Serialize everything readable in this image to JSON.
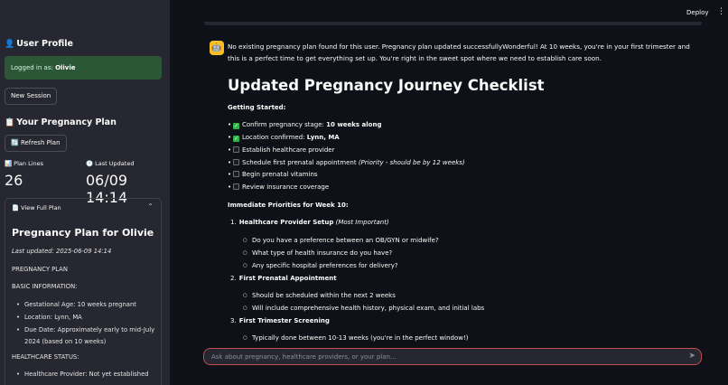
{
  "sidebar": {
    "user_profile_heading": "User Profile",
    "logged_in_prefix": "Logged in as:",
    "username": "Olivie",
    "new_session_label": "New Session",
    "plan_heading": "Your Pregnancy Plan",
    "refresh_label": "Refresh Plan",
    "metrics": [
      {
        "label": "Plan Lines",
        "value": "26"
      },
      {
        "label": "Last Updated",
        "value": "06/09 14:14"
      }
    ],
    "expander_label": "View Full Plan",
    "plan": {
      "title": "Pregnancy Plan for Olivie",
      "last_updated": "Last updated: 2025-06-09 14:14",
      "heading": "PREGNANCY PLAN",
      "basic_info_heading": "BASIC INFORMATION:",
      "basic_info": [
        "Gestational Age: 10 weeks pregnant",
        "Location: Lynn, MA",
        "Due Date: Approximately early to mid-July 2024 (based on 10 weeks)"
      ],
      "healthcare_heading": "HEALTHCARE STATUS:",
      "healthcare": [
        "Healthcare Provider: Not yet established"
      ]
    }
  },
  "header": {
    "deploy_label": "Deploy",
    "menu_icon": "⋮"
  },
  "chat": {
    "assistant_intro": "No existing pregnancy plan found for this user. Pregnancy plan updated successfullyWonderful! At 10 weeks, you're in your first trimester and this is a perfect time to get everything set up. You're right in the sweet spot where we need to establish care soon.",
    "checklist_title": "Updated Pregnancy Journey Checklist",
    "getting_started_heading": "Getting Started:",
    "checklist": [
      {
        "done": true,
        "text": "Confirm pregnancy stage: ",
        "bold": "10 weeks along",
        "note": ""
      },
      {
        "done": true,
        "text": "Location confirmed: ",
        "bold": "Lynn, MA",
        "note": ""
      },
      {
        "done": false,
        "text": "Establish healthcare provider",
        "bold": "",
        "note": ""
      },
      {
        "done": false,
        "text": "Schedule first prenatal appointment ",
        "bold": "",
        "note": "(Priority - should be by 12 weeks)"
      },
      {
        "done": false,
        "text": "Begin prenatal vitamins",
        "bold": "",
        "note": ""
      },
      {
        "done": false,
        "text": "Review insurance coverage",
        "bold": "",
        "note": ""
      }
    ],
    "priorities_heading": "Immediate Priorities for Week 10:",
    "priorities": [
      {
        "num": "1.",
        "title": "Healthcare Provider Setup",
        "note": " (Most Important)",
        "items": [
          "Do you have a preference between an OB/GYN or midwife?",
          "What type of health insurance do you have?",
          "Any specific hospital preferences for delivery?"
        ]
      },
      {
        "num": "2.",
        "title": "First Prenatal Appointment",
        "note": "",
        "items": [
          "Should be scheduled within the next 2 weeks",
          "Will include comprehensive health history, physical exam, and initial labs"
        ]
      },
      {
        "num": "3.",
        "title": "First Trimester Screening",
        "note": "",
        "items": [
          "Typically done between 10-13 weeks (you're in the perfect window!)"
        ]
      }
    ],
    "input_placeholder": "Ask about pregnancy, healthcare providers, or your plan..."
  }
}
